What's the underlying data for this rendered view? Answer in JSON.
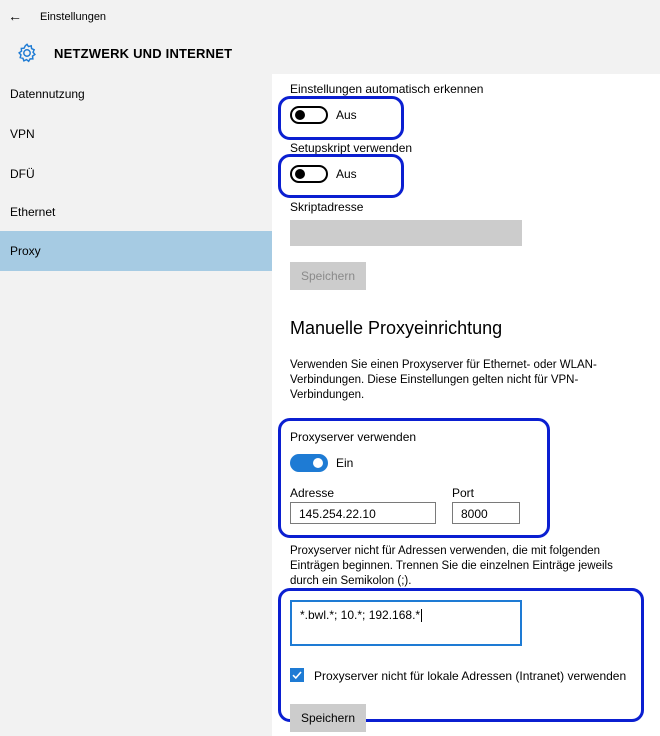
{
  "titlebar": {
    "back_glyph": "←",
    "title": "Einstellungen"
  },
  "header": {
    "icon": "gear-icon",
    "title": "NETZWERK UND INTERNET"
  },
  "sidebar": {
    "items": [
      {
        "label": "Datennutzung",
        "active": false
      },
      {
        "label": "VPN",
        "active": false
      },
      {
        "label": "DFÜ",
        "active": false
      },
      {
        "label": "Ethernet",
        "active": false
      },
      {
        "label": "Proxy",
        "active": true
      }
    ]
  },
  "auto": {
    "detect_label": "Einstellungen automatisch erkennen",
    "detect_state": "Aus",
    "script_label": "Setupskript verwenden",
    "script_state": "Aus",
    "address_label": "Skriptadresse",
    "save_label": "Speichern"
  },
  "manual": {
    "title": "Manuelle Proxyeinrichtung",
    "description_lines": [
      "Verwenden Sie einen Proxyserver für Ethernet- oder WLAN-",
      "Verbindungen. Diese Einstellungen gelten nicht für VPN-",
      "Verbindungen."
    ],
    "use_proxy_label": "Proxyserver verwenden",
    "use_proxy_state": "Ein",
    "address_label": "Adresse",
    "address_value": "145.254.22.10",
    "port_label": "Port",
    "port_value": "8000",
    "exceptions_lines": [
      "Proxyserver nicht für Adressen verwenden, die mit folgenden",
      "Einträgen beginnen. Trennen Sie die einzelnen Einträge jeweils",
      "durch ein Semikolon (;)."
    ],
    "exceptions_value": "*.bwl.*; 10.*; 192.168.*",
    "local_checkbox_label": "Proxyserver nicht für lokale Adressen (Intranet) verwenden",
    "save_label": "Speichern"
  },
  "colors": {
    "accent": "#1e7bd4",
    "selection": "#a6cbe3",
    "annotation": "#0b1fd1"
  }
}
